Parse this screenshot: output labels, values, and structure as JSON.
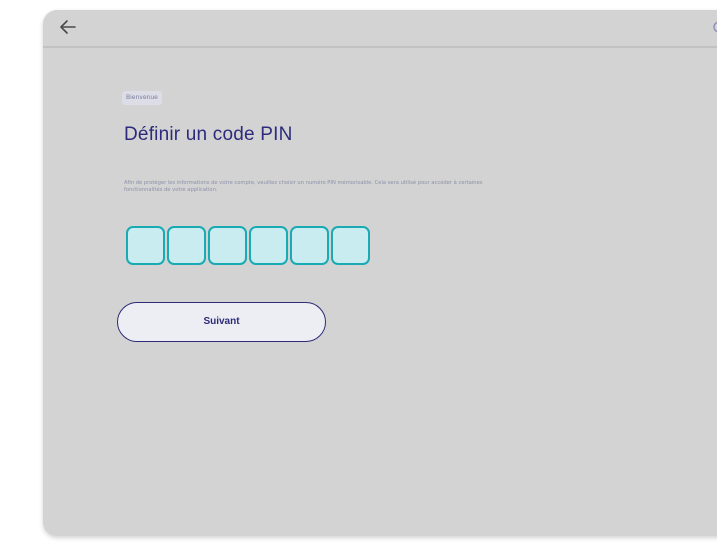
{
  "header": {
    "back_icon": "arrow-left-icon",
    "right_icon": "settings-icon"
  },
  "content": {
    "tag_label": "Bienvenue",
    "title": "Définir un code PIN",
    "description": "Afin de protéger les informations de votre compte, veuillez choisir un numéro PIN mémorisable. Cela sera utilisé pour accéder à certaines fonctionnalités de votre application.",
    "pin_length": 6
  },
  "actions": {
    "next_label": "Suivant"
  },
  "colors": {
    "background": "#d3d3d3",
    "title": "#2c2b7c",
    "pin_fill": "#c8ecef",
    "pin_border": "#1aaab3",
    "button_border": "#2d2b78",
    "button_fill": "#eceef3"
  }
}
